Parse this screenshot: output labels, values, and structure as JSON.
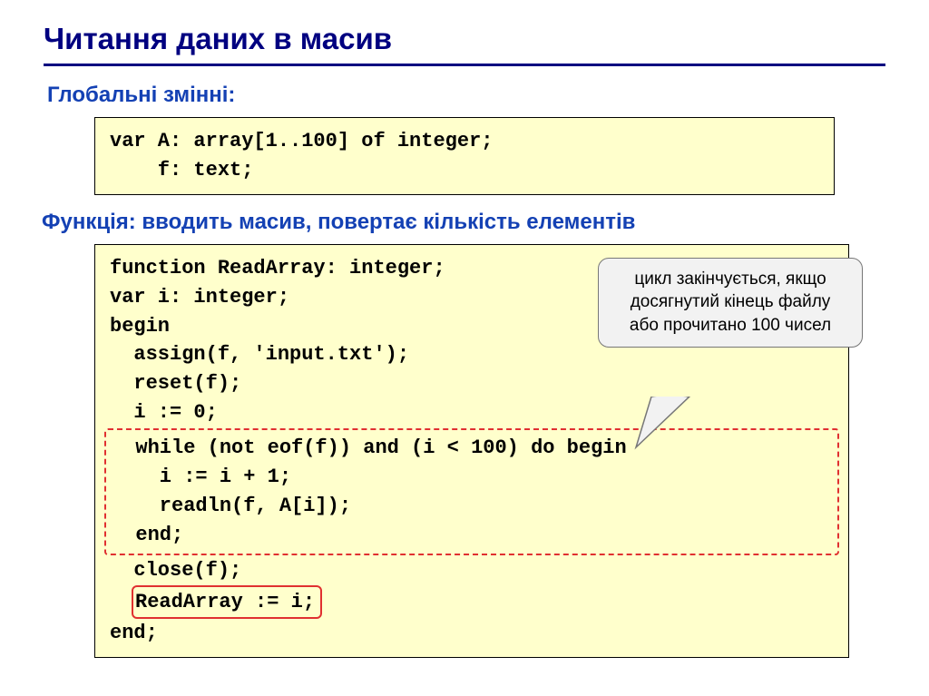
{
  "title": "Читання даних в масив",
  "subhead1": "Глобальні змінні:",
  "subhead2": "Функція: вводить масив, повертає кількість елементів",
  "globals": {
    "line1": "var A: array[1..100] of integer;",
    "line2": "    f: text;"
  },
  "func": {
    "l1": "function ReadArray: integer;",
    "l2": "var i: integer;",
    "l3": "begin",
    "l4": "  assign(f, 'input.txt');",
    "l5": "  reset(f);",
    "l6": "  i := 0;",
    "w1": "  while (not eof(f)) and (i < 100) do begin",
    "w2": "    i := i + 1;",
    "w3": "    readln(f, A[i]);",
    "w4": "  end;",
    "l7": "  close(f);",
    "ret": "ReadArray := i;",
    "l8": "end;"
  },
  "callout": {
    "line1": "цикл закінчується, якщо",
    "line2": "досягнутий кінець файлу",
    "line3": "або прочитано 100 чисел"
  }
}
